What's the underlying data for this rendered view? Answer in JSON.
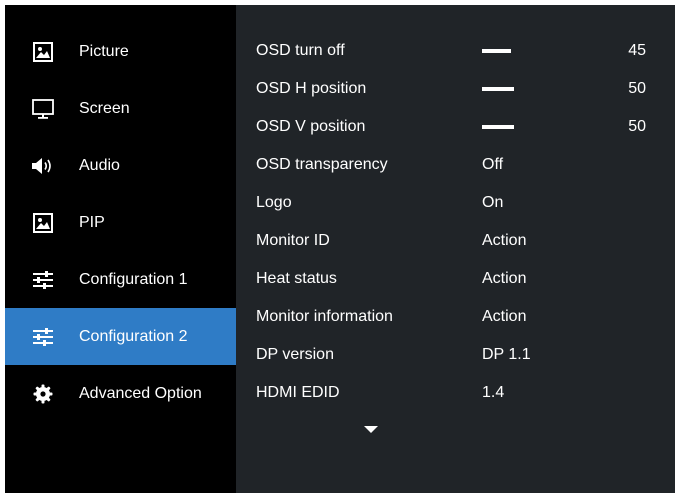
{
  "sidebar": {
    "items": [
      {
        "label": "Picture",
        "icon": "picture-icon"
      },
      {
        "label": "Screen",
        "icon": "monitor-icon"
      },
      {
        "label": "Audio",
        "icon": "speaker-icon"
      },
      {
        "label": "PIP",
        "icon": "picture-in-picture-icon"
      },
      {
        "label": "Configuration 1",
        "icon": "sliders-icon"
      },
      {
        "label": "Configuration 2",
        "icon": "sliders-icon"
      },
      {
        "label": "Advanced Option",
        "icon": "gear-icon"
      }
    ],
    "active_index": 5,
    "active_color": "#2f7cc6"
  },
  "menu": {
    "rows": [
      {
        "label": "OSD turn off",
        "type": "slider",
        "value": "45",
        "level": 0.45
      },
      {
        "label": "OSD H position",
        "type": "slider",
        "value": "50",
        "level": 0.5
      },
      {
        "label": "OSD V position",
        "type": "slider",
        "value": "50",
        "level": 0.5
      },
      {
        "label": "OSD transparency",
        "type": "text",
        "value": "Off"
      },
      {
        "label": "Logo",
        "type": "text",
        "value": "On"
      },
      {
        "label": "Monitor ID",
        "type": "text",
        "value": "Action"
      },
      {
        "label": "Heat status",
        "type": "text",
        "value": "Action"
      },
      {
        "label": "Monitor information",
        "type": "text",
        "value": "Action"
      },
      {
        "label": "DP version",
        "type": "text",
        "value": "DP 1.1"
      },
      {
        "label": "HDMI EDID",
        "type": "text",
        "value": "1.4"
      }
    ],
    "scroll_indicator": "chevron-down-icon"
  },
  "colors": {
    "sidebar_bg": "#000000",
    "panel_bg": "#202428",
    "highlight": "#2f7cc6",
    "text": "#ffffff"
  }
}
